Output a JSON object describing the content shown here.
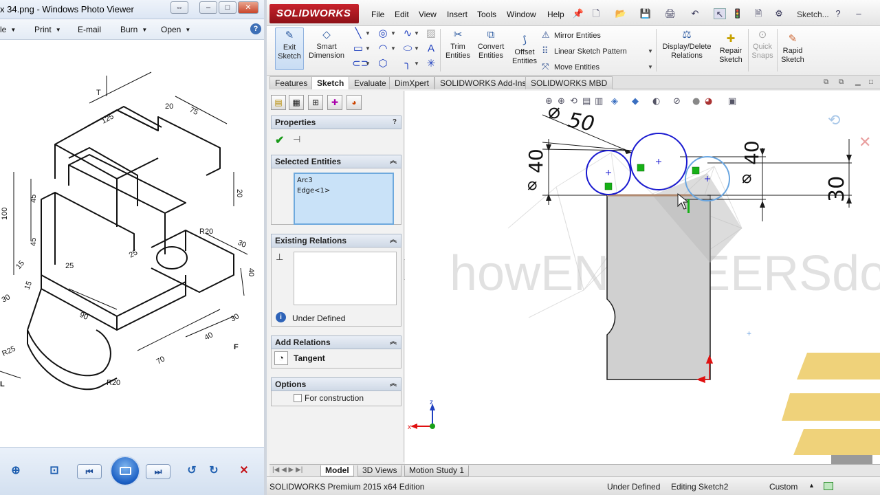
{
  "photo_viewer": {
    "title": "x 34.png - Windows Photo Viewer",
    "menu": {
      "file": "le",
      "print": "Print",
      "email": "E-mail",
      "burn": "Burn",
      "open": "Open"
    },
    "help": "?",
    "drawing_labels": {
      "t": "T",
      "d125": "125",
      "d20": "20",
      "d75": "75",
      "d100": "100",
      "d45a": "45",
      "d45b": "45",
      "d25a": "25",
      "d25b": "25",
      "d20b": "20",
      "r20": "R20",
      "d30a": "30",
      "d40": "40",
      "d15a": "15",
      "d15b": "15",
      "d30b": "30",
      "d90": "90",
      "d40b": "40",
      "d30c": "30",
      "r25": "R25",
      "r20b": "R20",
      "d70": "70",
      "f": "F",
      "l": "L"
    }
  },
  "solidworks": {
    "logo": "SOLIDWORKS",
    "menus": [
      "File",
      "Edit",
      "View",
      "Insert",
      "Tools",
      "Window",
      "Help"
    ],
    "search_label": "Sketch...",
    "ribbon": {
      "exit_sketch": [
        "Exit",
        "Sketch"
      ],
      "smart_dimension": [
        "Smart",
        "Dimension"
      ],
      "trim_entities": [
        "Trim",
        "Entities"
      ],
      "convert_entities": [
        "Convert",
        "Entities"
      ],
      "offset_entities": [
        "Offset",
        "Entities"
      ],
      "mirror_entities": "Mirror Entities",
      "linear_pattern": "Linear Sketch Pattern",
      "move_entities": "Move Entities",
      "display_delete_relations": [
        "Display/Delete",
        "Relations"
      ],
      "repair_sketch": [
        "Repair",
        "Sketch"
      ],
      "quick_snaps": [
        "Quick",
        "Snaps"
      ],
      "rapid_sketch": [
        "Rapid",
        "Sketch"
      ]
    },
    "cm_tabs": [
      "Features",
      "Sketch",
      "Evaluate",
      "DimXpert",
      "SOLIDWORKS Add-Ins",
      "SOLIDWORKS MBD"
    ],
    "active_tab": "Sketch",
    "property_manager": {
      "title": "Properties",
      "help": "?",
      "selected_entities_header": "Selected Entities",
      "selected_entities": [
        "Arc3",
        "Edge<1>"
      ],
      "existing_relations_header": "Existing Relations",
      "status": "Under Defined",
      "add_relations_header": "Add Relations",
      "add_relations": [
        "Tangent"
      ],
      "options_header": "Options",
      "for_construction": "For construction",
      "for_construction_checked": false
    },
    "dimensions": {
      "dia50": "50",
      "dia40_left": "40",
      "dia40_right": "40",
      "d30": "30"
    },
    "watermark": "howENGINEERSdoit!",
    "triad": {
      "x": "x",
      "z": "z"
    },
    "bottom_tabs": [
      "Model",
      "3D Views",
      "Motion Study 1"
    ],
    "active_bottom_tab": "Model",
    "status_bar": {
      "edition": "SOLIDWORKS Premium 2015 x64 Edition",
      "sketch_state": "Under Defined",
      "editing": "Editing Sketch2",
      "units": "Custom"
    },
    "colors": {
      "sketch_blue": "#1a1ad0",
      "relation_green": "#16b016",
      "brand_red": "#c8232c"
    }
  }
}
